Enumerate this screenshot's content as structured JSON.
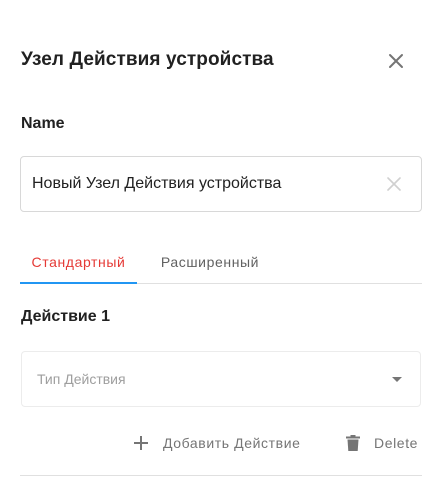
{
  "dialog": {
    "title": "Узел Действия устройства",
    "close_icon": "close-icon"
  },
  "name_field": {
    "label": "Name",
    "value": "Новый Узел Действия устройства",
    "clear_icon": "clear-icon"
  },
  "tabs": [
    {
      "label": "Стандартный",
      "active": true
    },
    {
      "label": "Расширенный",
      "active": false
    }
  ],
  "colors": {
    "active_tab_text": "#e53935",
    "active_tab_indicator": "#2196f3"
  },
  "actions": {
    "heading": "Действие 1",
    "type_placeholder": "Тип Действия",
    "add_label": "Добавить Действие",
    "add_icon": "plus-icon",
    "delete_label": "Delete",
    "delete_icon": "trash-icon"
  }
}
